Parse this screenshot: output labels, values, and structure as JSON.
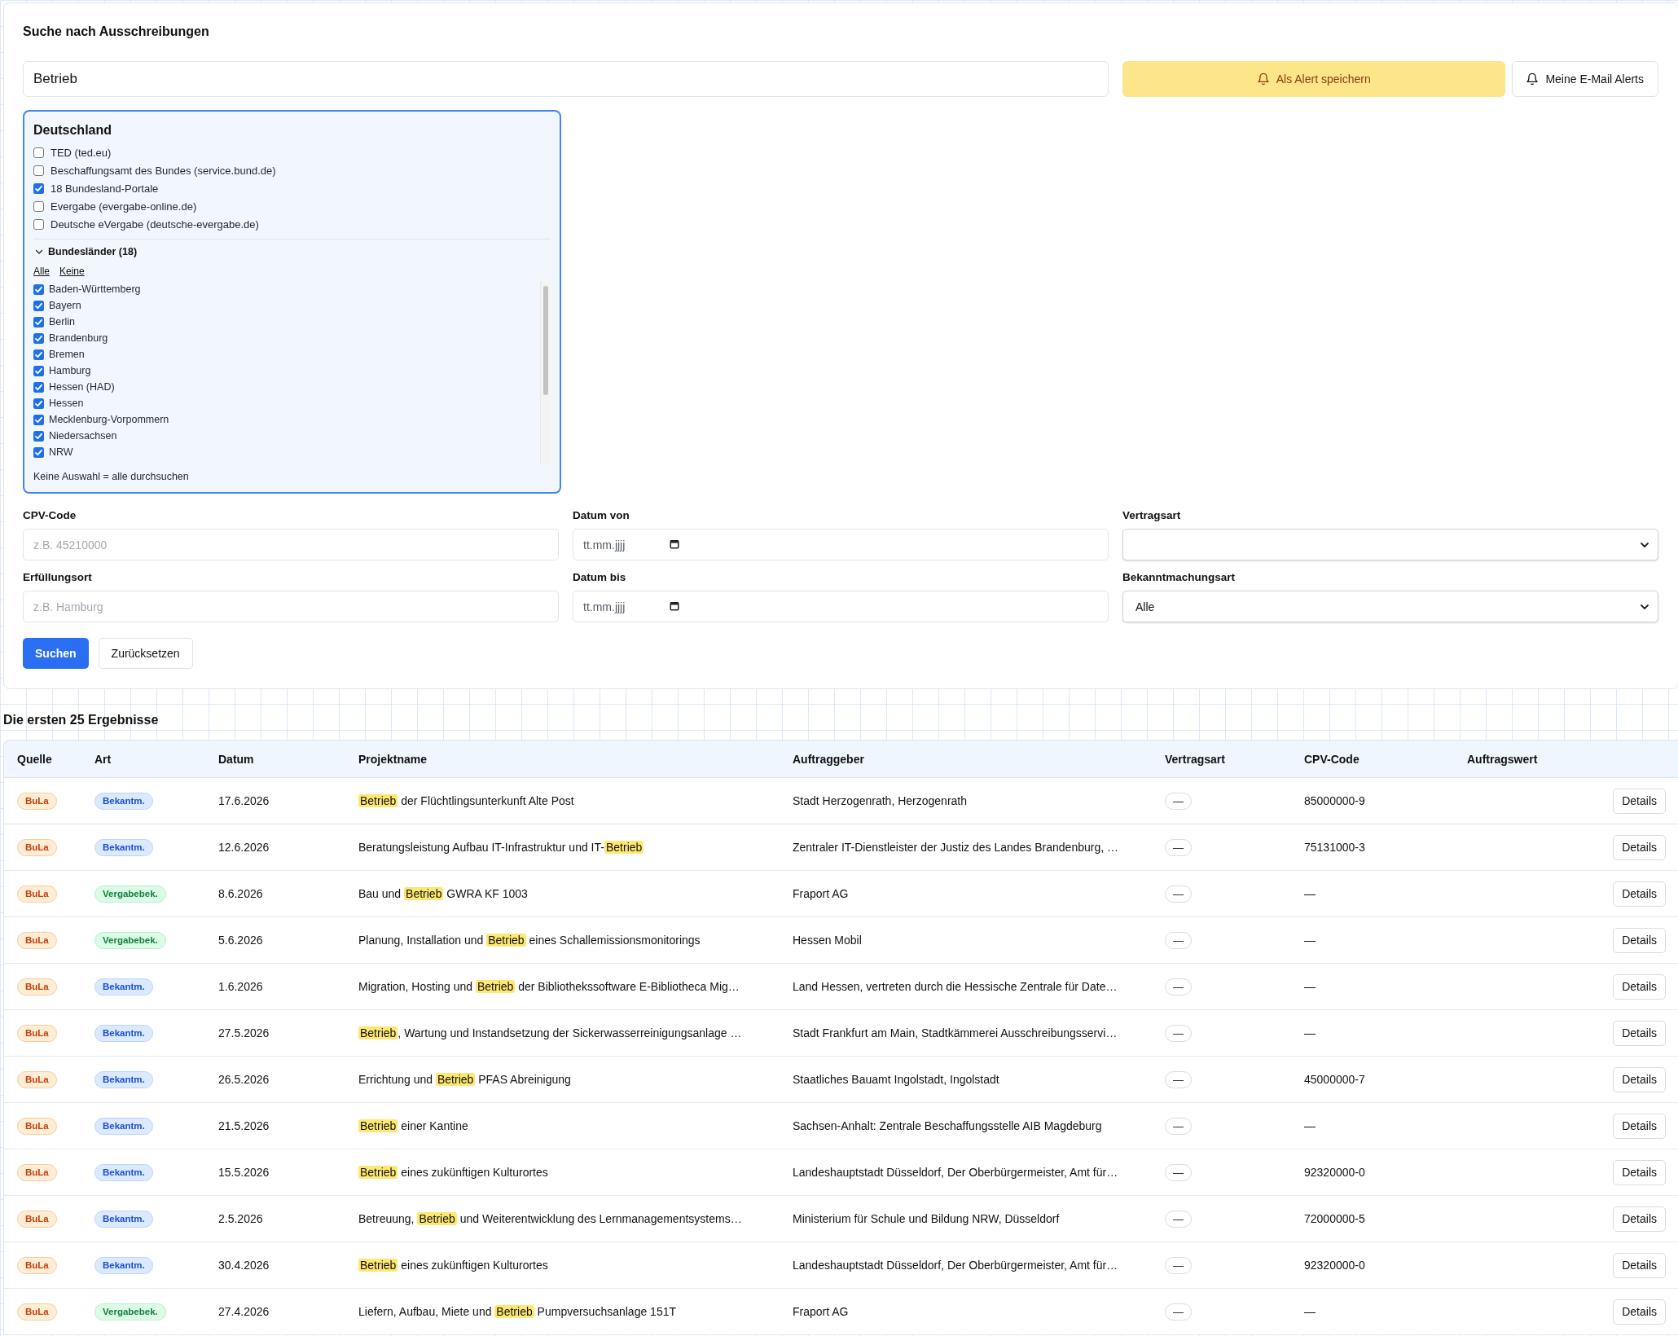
{
  "search_panel": {
    "title": "Suche nach Ausschreibungen",
    "query": {
      "value": "Betrieb"
    },
    "buttons": [
      {
        "label": "Als Alert speichern",
        "kind": "primary"
      },
      {
        "label": "Meine E-Mail Alerts",
        "kind": "secondary"
      }
    ],
    "sources": {
      "title": "Deutschland",
      "items": [
        {
          "label": "TED (ted.eu)",
          "checked": false
        },
        {
          "label": "Beschaffungsamt des Bundes (service.bund.de)",
          "checked": false
        },
        {
          "label": "18 Bundesland-Portale",
          "checked": true
        },
        {
          "label": "Evergabe (evergabe-online.de)",
          "checked": false
        },
        {
          "label": "Deutsche eVergabe (deutsche-evergabe.de)",
          "checked": false
        }
      ],
      "states": {
        "title": "Bundesländer (18)",
        "expanded": true,
        "links": [
          "Alle",
          "Keine"
        ],
        "items": [
          {
            "label": "Baden-Württemberg",
            "checked": true
          },
          {
            "label": "Bayern",
            "checked": true
          },
          {
            "label": "Berlin",
            "checked": true
          },
          {
            "label": "Brandenburg",
            "checked": true
          },
          {
            "label": "Bremen",
            "checked": true
          },
          {
            "label": "Hamburg",
            "checked": true
          },
          {
            "label": "Hessen (HAD)",
            "checked": true
          },
          {
            "label": "Hessen",
            "checked": true
          },
          {
            "label": "Mecklenburg-Vorpommern",
            "checked": true
          },
          {
            "label": "Niedersachsen",
            "checked": true
          },
          {
            "label": "NRW",
            "checked": true
          }
        ]
      },
      "hint": "Keine Auswahl = alle durchsuchen"
    },
    "filters": [
      {
        "label": "CPV-Code",
        "kind": "text",
        "placeholder": "z.B. 45210000"
      },
      {
        "label": "Datum von",
        "kind": "date",
        "placeholder": "tt.mm.jjjj"
      },
      {
        "label": "Vertragsart",
        "kind": "select"
      },
      {
        "label": "Erfüllungsort",
        "kind": "text",
        "placeholder": "z.B. Hamburg"
      },
      {
        "label": "Datum bis",
        "kind": "date",
        "placeholder": "tt.mm.jjjj"
      },
      {
        "label": "Bekanntmachungsart",
        "kind": "select",
        "value": "Alle"
      }
    ],
    "actions": [
      {
        "label": "Suchen",
        "kind": "primary"
      },
      {
        "label": "Zurücksetzen",
        "kind": "secondary"
      }
    ]
  },
  "results": {
    "title": "Die ersten 25 Ergebnisse",
    "table": {
      "columns": [
        "Quelle",
        "Art",
        "Datum",
        "Projektname",
        "Auftraggeber",
        "Vertragsart",
        "CPV-Code",
        "Auftragswert"
      ],
      "rows": [
        {
          "source": "BuLa",
          "type": {
            "label": "Bekantm.",
            "kind": "notice"
          },
          "date": "17.6.2026",
          "project": [
            {
              "text": "Betrieb",
              "highlight": true
            },
            {
              "text": " der Flüchtlingsunterkunft Alte Post",
              "highlight": false
            }
          ],
          "client": "Stadt Herzogenrath, Herzogenrath",
          "contract_type": "—",
          "cpv": "85000000-9",
          "action": "Details"
        },
        {
          "source": "BuLa",
          "type": {
            "label": "Bekantm.",
            "kind": "notice"
          },
          "date": "12.6.2026",
          "project": [
            {
              "text": "Beratungsleistung Aufbau IT-Infrastruktur und IT-",
              "highlight": false
            },
            {
              "text": "Betrieb",
              "highlight": true
            }
          ],
          "client": "Zentraler IT-Dienstleister der Justiz des Landes Brandenburg, …",
          "contract_type": "—",
          "cpv": "75131000-3",
          "action": "Details"
        },
        {
          "source": "BuLa",
          "type": {
            "label": "Vergabebek.",
            "kind": "award"
          },
          "date": "8.6.2026",
          "project": [
            {
              "text": "Bau und ",
              "highlight": false
            },
            {
              "text": "Betrieb",
              "highlight": true
            },
            {
              "text": " GWRA KF 1003",
              "highlight": false
            }
          ],
          "client": "Fraport AG",
          "contract_type": "—",
          "cpv": "—",
          "action": "Details"
        },
        {
          "source": "BuLa",
          "type": {
            "label": "Vergabebek.",
            "kind": "award"
          },
          "date": "5.6.2026",
          "project": [
            {
              "text": "Planung, Installation und ",
              "highlight": false
            },
            {
              "text": "Betrieb",
              "highlight": true
            },
            {
              "text": " eines Schallemissionsmonitorings",
              "highlight": false
            }
          ],
          "client": "Hessen Mobil",
          "contract_type": "—",
          "cpv": "—",
          "action": "Details"
        },
        {
          "source": "BuLa",
          "type": {
            "label": "Bekantm.",
            "kind": "notice"
          },
          "date": "1.6.2026",
          "project": [
            {
              "text": "Migration, Hosting und ",
              "highlight": false
            },
            {
              "text": "Betrieb",
              "highlight": true
            },
            {
              "text": " der Bibliothekssoftware E-Bibliotheca Mig…",
              "highlight": false
            }
          ],
          "client": "Land Hessen, vertreten durch die Hessische Zentrale für Date…",
          "contract_type": "—",
          "cpv": "—",
          "action": "Details"
        },
        {
          "source": "BuLa",
          "type": {
            "label": "Bekantm.",
            "kind": "notice"
          },
          "date": "27.5.2026",
          "project": [
            {
              "text": "Betrieb",
              "highlight": true
            },
            {
              "text": ", Wartung und Instandsetzung der Sickerwasserreinigungsanlage …",
              "highlight": false
            }
          ],
          "client": "Stadt Frankfurt am Main, Stadtkämmerei Ausschreibungsservi…",
          "contract_type": "—",
          "cpv": "—",
          "action": "Details"
        },
        {
          "source": "BuLa",
          "type": {
            "label": "Bekantm.",
            "kind": "notice"
          },
          "date": "26.5.2026",
          "project": [
            {
              "text": "Errichtung und ",
              "highlight": false
            },
            {
              "text": "Betrieb",
              "highlight": true
            },
            {
              "text": " PFAS Abreinigung",
              "highlight": false
            }
          ],
          "client": "Staatliches Bauamt Ingolstadt, Ingolstadt",
          "contract_type": "—",
          "cpv": "45000000-7",
          "action": "Details"
        },
        {
          "source": "BuLa",
          "type": {
            "label": "Bekantm.",
            "kind": "notice"
          },
          "date": "21.5.2026",
          "project": [
            {
              "text": "Betrieb",
              "highlight": true
            },
            {
              "text": " einer Kantine",
              "highlight": false
            }
          ],
          "client": "Sachsen-Anhalt: Zentrale Beschaffungsstelle AIB Magdeburg",
          "contract_type": "—",
          "cpv": "—",
          "action": "Details"
        },
        {
          "source": "BuLa",
          "type": {
            "label": "Bekantm.",
            "kind": "notice"
          },
          "date": "15.5.2026",
          "project": [
            {
              "text": "Betrieb",
              "highlight": true
            },
            {
              "text": " eines zukünftigen Kulturortes",
              "highlight": false
            }
          ],
          "client": "Landeshauptstadt Düsseldorf, Der Oberbürgermeister, Amt für…",
          "contract_type": "—",
          "cpv": "92320000-0",
          "action": "Details"
        },
        {
          "source": "BuLa",
          "type": {
            "label": "Bekantm.",
            "kind": "notice"
          },
          "date": "2.5.2026",
          "project": [
            {
              "text": "Betreuung, ",
              "highlight": false
            },
            {
              "text": "Betrieb",
              "highlight": true
            },
            {
              "text": " und Weiterentwicklung des Lernmanagementsystems…",
              "highlight": false
            }
          ],
          "client": "Ministerium für Schule und Bildung NRW, Düsseldorf",
          "contract_type": "—",
          "cpv": "72000000-5",
          "action": "Details"
        },
        {
          "source": "BuLa",
          "type": {
            "label": "Bekantm.",
            "kind": "notice"
          },
          "date": "30.4.2026",
          "project": [
            {
              "text": "Betrieb",
              "highlight": true
            },
            {
              "text": " eines zukünftigen Kulturortes",
              "highlight": false
            }
          ],
          "client": "Landeshauptstadt Düsseldorf, Der Oberbürgermeister, Amt für…",
          "contract_type": "—",
          "cpv": "92320000-0",
          "action": "Details"
        },
        {
          "source": "BuLa",
          "type": {
            "label": "Vergabebek.",
            "kind": "award"
          },
          "date": "27.4.2026",
          "project": [
            {
              "text": "Liefern, Aufbau, Miete und ",
              "highlight": false
            },
            {
              "text": "Betrieb",
              "highlight": true
            },
            {
              "text": " Pumpversuchsanlage 151T",
              "highlight": false
            }
          ],
          "client": "Fraport AG",
          "contract_type": "—",
          "cpv": "—",
          "action": "Details"
        }
      ]
    }
  }
}
